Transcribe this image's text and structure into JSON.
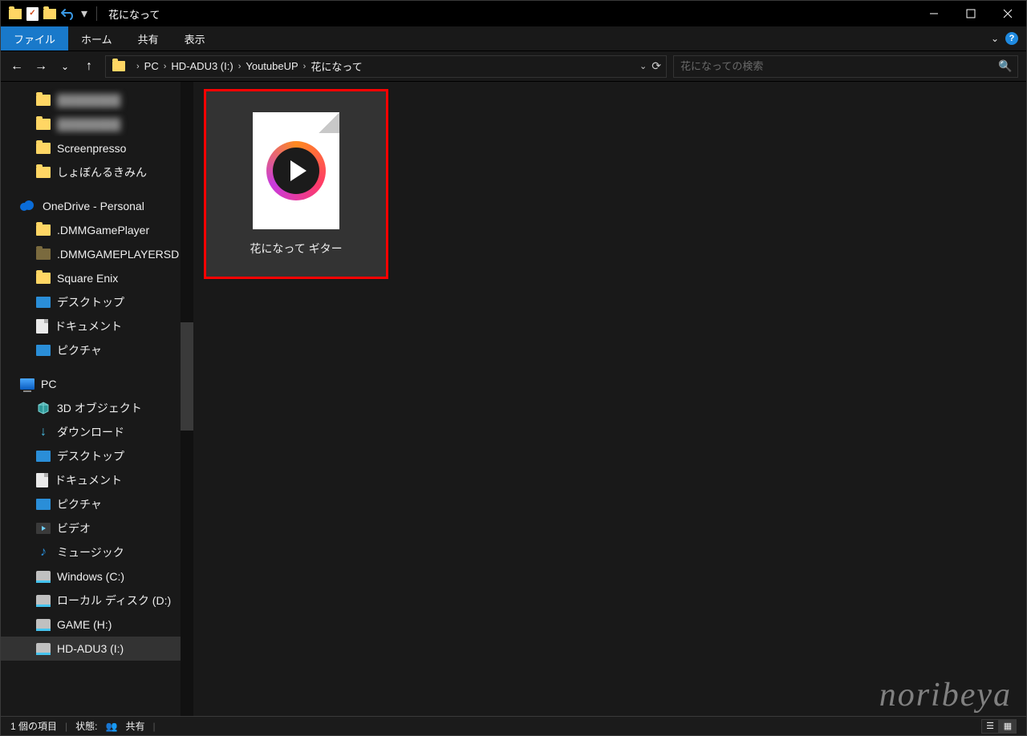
{
  "window": {
    "title": "花になって"
  },
  "ribbon": {
    "file": "ファイル",
    "tabs": [
      "ホーム",
      "共有",
      "表示"
    ]
  },
  "breadcrumb": {
    "segments": [
      "PC",
      "HD-ADU3 (I:)",
      "YoutubeUP",
      "花になって"
    ]
  },
  "search": {
    "placeholder": "花になっての検索"
  },
  "sidebar": {
    "items": [
      {
        "label": "████████",
        "icon": "folder",
        "blur": true
      },
      {
        "label": "████████",
        "icon": "folder",
        "blur": true
      },
      {
        "label": "Screenpresso",
        "icon": "folder"
      },
      {
        "label": "しょぼんるきみん",
        "icon": "folder"
      },
      {
        "label": "OneDrive - Personal",
        "icon": "onedrive",
        "lvl": 0
      },
      {
        "label": ".DMMGamePlayer",
        "icon": "folder"
      },
      {
        "label": ".DMMGAMEPLAYERSD",
        "icon": "folder-dim"
      },
      {
        "label": "Square Enix",
        "icon": "folder"
      },
      {
        "label": "デスクトップ",
        "icon": "pic"
      },
      {
        "label": "ドキュメント",
        "icon": "doc"
      },
      {
        "label": "ピクチャ",
        "icon": "pic"
      },
      {
        "label": "PC",
        "icon": "pc",
        "lvl": 0
      },
      {
        "label": "3D オブジェクト",
        "icon": "3d"
      },
      {
        "label": "ダウンロード",
        "icon": "download"
      },
      {
        "label": "デスクトップ",
        "icon": "pic"
      },
      {
        "label": "ドキュメント",
        "icon": "doc"
      },
      {
        "label": "ピクチャ",
        "icon": "pic"
      },
      {
        "label": "ビデオ",
        "icon": "video"
      },
      {
        "label": "ミュージック",
        "icon": "music"
      },
      {
        "label": "Windows (C:)",
        "icon": "disk"
      },
      {
        "label": "ローカル ディスク (D:)",
        "icon": "disk"
      },
      {
        "label": "GAME (H:)",
        "icon": "disk"
      },
      {
        "label": "HD-ADU3 (I:)",
        "icon": "disk",
        "selected": true
      }
    ]
  },
  "content": {
    "files": [
      {
        "label": "花になって ギター",
        "kind": "video",
        "highlighted": true
      }
    ]
  },
  "status": {
    "item_count": "1 個の項目",
    "state_label": "状態:",
    "state_value": "共有"
  },
  "watermark": "noribeya"
}
